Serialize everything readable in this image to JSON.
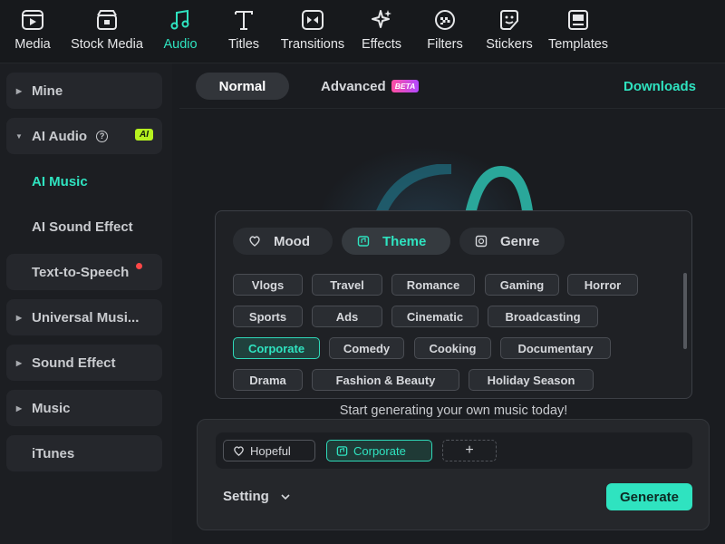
{
  "toolbar": {
    "items": [
      {
        "label": "Media",
        "icon": "media-icon"
      },
      {
        "label": "Stock Media",
        "icon": "stock-media-icon"
      },
      {
        "label": "Audio",
        "icon": "music-note-icon"
      },
      {
        "label": "Titles",
        "icon": "text-t-icon"
      },
      {
        "label": "Transitions",
        "icon": "transition-icon"
      },
      {
        "label": "Effects",
        "icon": "sparkle-icon"
      },
      {
        "label": "Filters",
        "icon": "filter-icon"
      },
      {
        "label": "Stickers",
        "icon": "sticker-icon"
      },
      {
        "label": "Templates",
        "icon": "template-icon"
      }
    ],
    "active": "Audio"
  },
  "sidebar": {
    "items": [
      {
        "label": "Mine"
      },
      {
        "label": "AI Audio",
        "badge": "AI"
      },
      {
        "label": "AI Music"
      },
      {
        "label": "AI Sound Effect"
      },
      {
        "label": "Text-to-Speech"
      },
      {
        "label": "Universal Musi..."
      },
      {
        "label": "Sound Effect"
      },
      {
        "label": "Music"
      },
      {
        "label": "iTunes"
      }
    ]
  },
  "header": {
    "tab_normal": "Normal",
    "tab_advanced": "Advanced",
    "beta_badge": "BETA",
    "downloads": "Downloads"
  },
  "categories": {
    "mood": "Mood",
    "theme": "Theme",
    "genre": "Genre",
    "active": "Theme"
  },
  "themes": {
    "row1": [
      "Vlogs",
      "Travel",
      "Romance",
      "Gaming",
      "Horror"
    ],
    "row2": [
      "Sports",
      "Ads",
      "Cinematic",
      "Broadcasting"
    ],
    "row3": [
      "Corporate",
      "Comedy",
      "Cooking",
      "Documentary"
    ],
    "row4": [
      "Drama",
      "Fashion & Beauty",
      "Holiday Season"
    ],
    "selected": "Corporate"
  },
  "hint": "Start generating your own music today!",
  "prompt": {
    "tags": [
      "Hopeful",
      "Corporate"
    ],
    "add": "+",
    "setting_label": "Setting",
    "generate_label": "Generate"
  },
  "colors": {
    "accent": "#2fe3c0",
    "background": "#1a1c20",
    "ai_badge": "#b6f21f"
  }
}
